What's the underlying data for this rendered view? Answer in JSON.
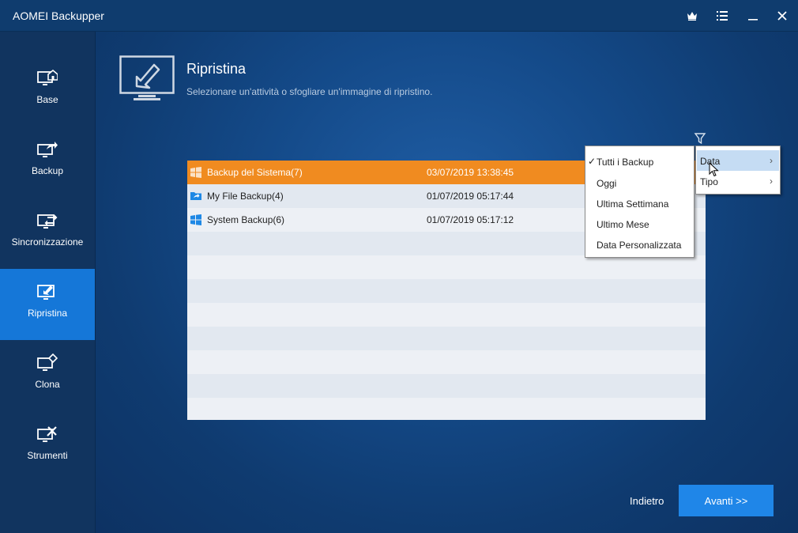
{
  "app": {
    "title": "AOMEI Backupper"
  },
  "titlebar": {
    "icons": [
      "crown-icon",
      "menu-list-icon",
      "minimize-icon",
      "close-icon"
    ]
  },
  "sidebar": {
    "items": [
      {
        "label": "Base",
        "icon": "home-monitor-icon",
        "active": false
      },
      {
        "label": "Backup",
        "icon": "backup-share-icon",
        "active": false
      },
      {
        "label": "Sincronizzazione",
        "icon": "sync-icon",
        "active": false
      },
      {
        "label": "Ripristina",
        "icon": "restore-icon",
        "active": true
      },
      {
        "label": "Clona",
        "icon": "clone-icon",
        "active": false
      },
      {
        "label": "Strumenti",
        "icon": "tools-icon",
        "active": false
      }
    ]
  },
  "page": {
    "title": "Ripristina",
    "subtitle": "Selezionare un'attività o sfogliare un'immagine di ripristino."
  },
  "table": {
    "rows": [
      {
        "name": "Backup del Sistema(7)",
        "date": "03/07/2019 13:38:45",
        "icon": "windows-icon",
        "selected": true
      },
      {
        "name": "My File Backup(4)",
        "date": "01/07/2019 05:17:44",
        "icon": "folder-icon",
        "selected": false
      },
      {
        "name": "System Backup(6)",
        "date": "01/07/2019 05:17:12",
        "icon": "windows-icon",
        "selected": false
      }
    ]
  },
  "filter_menu": {
    "items": [
      {
        "label": "Tutti i Backup",
        "checked": true
      },
      {
        "label": "Oggi",
        "checked": false
      },
      {
        "label": "Ultima Settimana",
        "checked": false
      },
      {
        "label": "Ultimo Mese",
        "checked": false
      },
      {
        "label": "Data Personalizzata",
        "checked": false
      }
    ]
  },
  "filter_submenu": {
    "items": [
      {
        "label": "Data",
        "hover": true
      },
      {
        "label": "Tipo",
        "hover": false
      }
    ]
  },
  "footer": {
    "back_label": "Indietro",
    "next_label": "Avanti >>"
  },
  "colors": {
    "accent": "#1577d8",
    "selected_row": "#f08b20",
    "next_button": "#1f86e8"
  }
}
